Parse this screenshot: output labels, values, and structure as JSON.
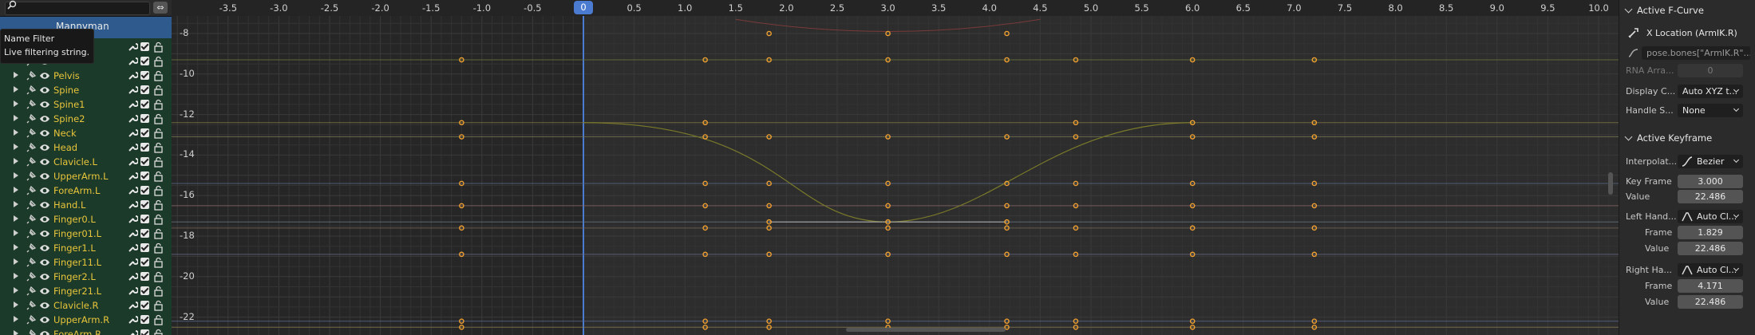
{
  "channel_list": {
    "search_placeholder": "",
    "object_label": "Mannyman",
    "tooltip": {
      "title": "Name Filter",
      "description": "Live filtering string."
    },
    "channels": [
      {
        "label": ""
      },
      {
        "label": ""
      },
      {
        "label": "Pelvis"
      },
      {
        "label": "Spine"
      },
      {
        "label": "Spine1"
      },
      {
        "label": "Spine2"
      },
      {
        "label": "Neck"
      },
      {
        "label": "Head"
      },
      {
        "label": "Clavicle.L"
      },
      {
        "label": "UpperArm.L"
      },
      {
        "label": "ForeArm.L"
      },
      {
        "label": "Hand.L"
      },
      {
        "label": "Finger0.L"
      },
      {
        "label": "Finger01.L"
      },
      {
        "label": "Finger1.L"
      },
      {
        "label": "Finger11.L"
      },
      {
        "label": "Finger2.L"
      },
      {
        "label": "Finger21.L"
      },
      {
        "label": "Clavicle.R"
      },
      {
        "label": "UpperArm.R"
      },
      {
        "label": "ForeArm.R"
      }
    ]
  },
  "graph": {
    "current_frame": "0",
    "x_ticks": [
      "-3.5",
      "-3.0",
      "-2.5",
      "-2.0",
      "-1.5",
      "-1.0",
      "-0.5",
      "0.5",
      "1.0",
      "1.5",
      "2.0",
      "2.5",
      "3.0",
      "3.5",
      "4.0",
      "4.5",
      "5.0",
      "5.5",
      "6.0",
      "6.5",
      "7.0",
      "7.5",
      "8.0",
      "8.5",
      "9.0",
      "9.5",
      "10.0"
    ],
    "y_ticks": [
      "-8",
      "-10",
      "-12",
      "-14",
      "-16",
      "-18",
      "-20",
      "-22"
    ]
  },
  "sidebar": {
    "fcurve": {
      "title": "Active F-Curve",
      "name": "X Location (ArmIK.R)",
      "data_path": "pose.bones[\"ArmIK.R\"...",
      "rna_label": "RNA Arra...",
      "rna_value": "0",
      "display_label": "Display C...",
      "display_value": "Auto XYZ t...",
      "handle_label": "Handle S...",
      "handle_value": "None"
    },
    "keyframe": {
      "title": "Active Keyframe",
      "interp_label": "Interpolat...",
      "interp_value": "Bezier",
      "key_frame_label": "Key Frame",
      "key_frame_value": "3.000",
      "value_label": "Value",
      "value_value": "22.486",
      "left_handle_label": "Left Hand...",
      "left_handle_type": "Auto Cl...",
      "left_frame_label": "Frame",
      "left_frame_value": "1.829",
      "left_value_label": "Value",
      "left_value_value": "22.486",
      "right_handle_label": "Right Ha...",
      "right_handle_type": "Auto Cl...",
      "right_frame_label": "Frame",
      "right_frame_value": "4.171",
      "right_value_label": "Value",
      "right_value_value": "22.486"
    }
  },
  "colors": {
    "accent": "#4b7bd0",
    "keyframe": "#f0a030",
    "channel_text": "#e8c53a",
    "channel_bg": "#1c3a2a"
  }
}
